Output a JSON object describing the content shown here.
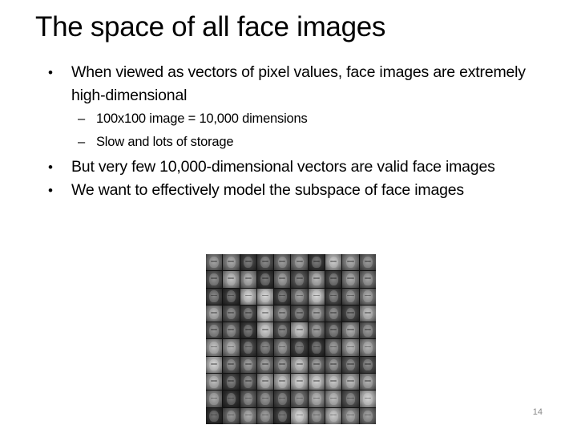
{
  "slide": {
    "title": "The space of all face images",
    "bullets": [
      {
        "text": "When viewed as vectors of pixel values, face images are extremely high-dimensional",
        "sub": [
          "100x100 image = 10,000 dimensions",
          "Slow and lots of storage"
        ]
      },
      {
        "text": "But very few 10,000-dimensional vectors are valid face images",
        "sub": []
      },
      {
        "text": "We want to effectively model the subspace of face images",
        "sub": []
      }
    ],
    "bullet_glyph": "•",
    "sub_glyph": "–",
    "image": {
      "description": "10x10 grid of grayscale face images",
      "rows": 10,
      "cols": 10
    },
    "page_number": "14"
  }
}
